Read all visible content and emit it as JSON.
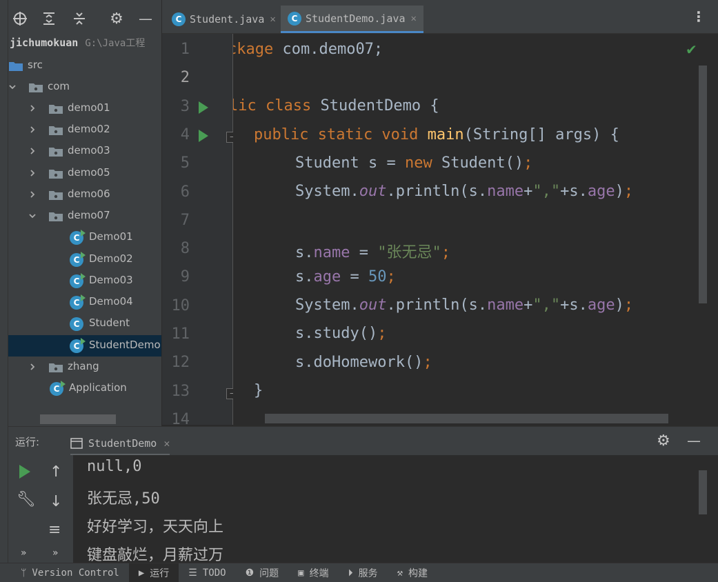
{
  "project": {
    "root_name": "jichumokuan",
    "root_path": "G:\\Java工程",
    "tree": [
      {
        "label": "src",
        "kind": "folder",
        "expanded": null
      },
      {
        "label": "com",
        "kind": "folder",
        "expanded": true
      },
      {
        "label": "demo01",
        "kind": "folder",
        "expanded": false
      },
      {
        "label": "demo02",
        "kind": "folder",
        "expanded": false
      },
      {
        "label": "demo03",
        "kind": "folder",
        "expanded": false
      },
      {
        "label": "demo05",
        "kind": "folder",
        "expanded": false
      },
      {
        "label": "demo06",
        "kind": "folder",
        "expanded": false
      },
      {
        "label": "demo07",
        "kind": "folder",
        "expanded": true
      },
      {
        "label": "Demo01",
        "kind": "class-run"
      },
      {
        "label": "Demo02",
        "kind": "class-run"
      },
      {
        "label": "Demo03",
        "kind": "class-run"
      },
      {
        "label": "Demo04",
        "kind": "class-run"
      },
      {
        "label": "Student",
        "kind": "class"
      },
      {
        "label": "StudentDemo",
        "kind": "class-run",
        "selected": true
      },
      {
        "label": "zhang",
        "kind": "folder",
        "expanded": false
      },
      {
        "label": "Application",
        "kind": "class-run"
      }
    ]
  },
  "tabs": [
    {
      "label": "Student.java",
      "active": false
    },
    {
      "label": "StudentDemo.java",
      "active": true
    }
  ],
  "editor": {
    "line_numbers": [
      "1",
      "2",
      "3",
      "4",
      "5",
      "6",
      "7",
      "8",
      "9",
      "10",
      "11",
      "12",
      "13",
      "14"
    ],
    "current_line": "2",
    "lines": [
      "ckage com.demo07;",
      "",
      "lic class StudentDemo {",
      "  public static void main(String[] args) {",
      "      Student s = new Student();",
      "      System.out.println(s.name+\",\"+s.age);",
      "",
      "      s.name = \"张无忌\";",
      "      s.age = 50;",
      "      System.out.println(s.name+\",\"+s.age);",
      "      s.study();",
      "      s.doHomework();",
      "  }",
      ""
    ]
  },
  "run": {
    "label": "运行:",
    "tab_label": "StudentDemo",
    "output": [
      "null,0",
      "张无忌,50",
      "好好学习，天天向上",
      "键盘敲烂，月薪过万"
    ]
  },
  "status_bar": [
    {
      "label": "Version Control",
      "icon": "branch-icon"
    },
    {
      "label": "运行",
      "icon": "play-icon",
      "active": true
    },
    {
      "label": "TODO",
      "icon": "list-icon"
    },
    {
      "label": "问题",
      "icon": "problem-icon"
    },
    {
      "label": "终端",
      "icon": "terminal-icon"
    },
    {
      "label": "服务",
      "icon": "services-icon"
    },
    {
      "label": "构建",
      "icon": "build-icon"
    }
  ],
  "colors": {
    "keyword": "#cc7832",
    "string": "#6a8759",
    "number": "#6897bb",
    "field": "#9876aa",
    "method_decl": "#ffc66d",
    "text": "#a9b7c6",
    "selection": "#0d293e"
  }
}
